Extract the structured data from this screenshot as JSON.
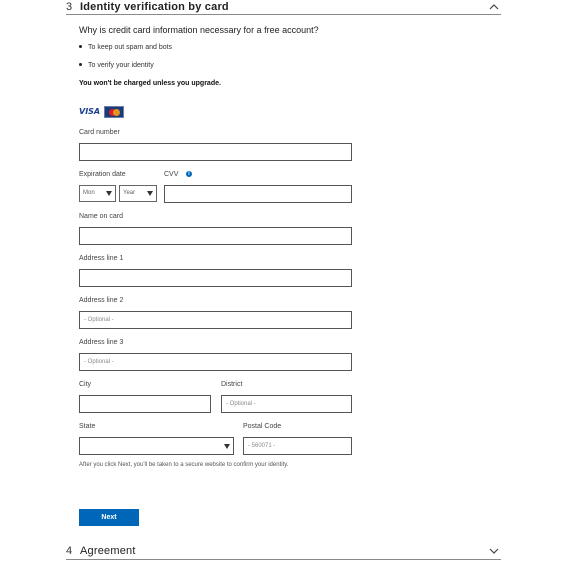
{
  "section3": {
    "number": "3",
    "title": "Identity verification by card",
    "expanded": true
  },
  "question": "Why is credit card information necessary for a free account?",
  "bullets": [
    "To keep out spam and bots",
    "To verify your identity"
  ],
  "charge_note": "You won't be charged unless you upgrade.",
  "card_logos": {
    "visa": "VISA",
    "mastercard_icon": "mastercard-icon"
  },
  "form": {
    "card_number": {
      "label": "Card number",
      "value": ""
    },
    "expiration": {
      "label": "Expiration date",
      "month_placeholder": "Mon",
      "year_placeholder": "Year"
    },
    "cvv": {
      "label": "CVV",
      "value": ""
    },
    "name_on_card": {
      "label": "Name on card",
      "value": ""
    },
    "address1": {
      "label": "Address line 1",
      "value": ""
    },
    "address2": {
      "label": "Address line 2",
      "placeholder": "- Optional -"
    },
    "address3": {
      "label": "Address line 3",
      "placeholder": "- Optional -"
    },
    "city": {
      "label": "City",
      "value": ""
    },
    "district": {
      "label": "District",
      "placeholder": "- Optional -"
    },
    "state": {
      "label": "State",
      "value": ""
    },
    "postal_code": {
      "label": "Postal Code",
      "placeholder": "- 560071 -"
    }
  },
  "footnote": "After you click Next, you'll be taken to a secure website to confirm your identity.",
  "next_button": "Next",
  "section4": {
    "number": "4",
    "title": "Agreement",
    "expanded": false
  },
  "colors": {
    "accent": "#0067b8",
    "border": "#555555"
  }
}
